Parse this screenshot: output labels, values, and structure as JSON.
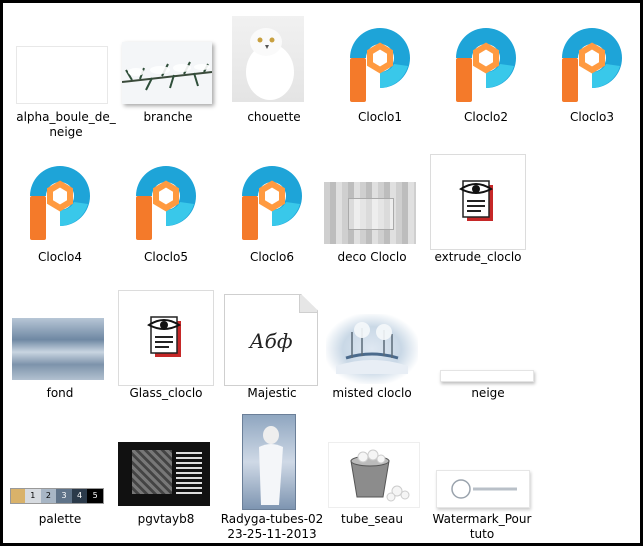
{
  "colors": {
    "logo_blue": "#1a9fd6",
    "logo_cyan": "#2ec2e6",
    "logo_orange": "#f47a2a",
    "logo_orange_light": "#ffa24a",
    "doc_red": "#c62828"
  },
  "files": [
    {
      "label": "alpha_boule_de_\nneige",
      "icon": "blank-image-icon"
    },
    {
      "label": "branche",
      "icon": "snowy-branch-thumbnail"
    },
    {
      "label": "chouette",
      "icon": "snowy-owl-thumbnail"
    },
    {
      "label": "Cloclo1",
      "icon": "picsart-logo-icon"
    },
    {
      "label": "Cloclo2",
      "icon": "picsart-logo-icon"
    },
    {
      "label": "Cloclo3",
      "icon": "picsart-logo-icon"
    },
    {
      "label": "Cloclo4",
      "icon": "picsart-logo-icon"
    },
    {
      "label": "Cloclo5",
      "icon": "picsart-logo-icon"
    },
    {
      "label": "Cloclo6",
      "icon": "picsart-logo-icon"
    },
    {
      "label": "deco Cloclo",
      "icon": "gray-texture-thumbnail"
    },
    {
      "label": "extrude_cloclo",
      "icon": "eye-document-icon"
    },
    {
      "label": "fond",
      "icon": "blue-blur-thumbnail"
    },
    {
      "label": "Glass_cloclo",
      "icon": "eye-document-icon"
    },
    {
      "label": "Majestic",
      "icon": "font-file-icon",
      "font_preview": "Абф"
    },
    {
      "label": "misted cloclo",
      "icon": "winter-landscape-thumbnail"
    },
    {
      "label": "neige",
      "icon": "thin-strip-thumbnail"
    },
    {
      "label": "palette",
      "icon": "color-palette-thumbnail",
      "swatches": [
        "1",
        "2",
        "3",
        "4",
        "5"
      ]
    },
    {
      "label": "pgvtayb8",
      "icon": "dark-pattern-thumbnail"
    },
    {
      "label": "Radyga-tubes-02\n23-25-11-2013",
      "icon": "woman-tube-thumbnail"
    },
    {
      "label": "tube_seau",
      "icon": "snow-bucket-thumbnail"
    },
    {
      "label": "Watermark_Pour\ntuto",
      "icon": "watermark-thumbnail"
    }
  ]
}
